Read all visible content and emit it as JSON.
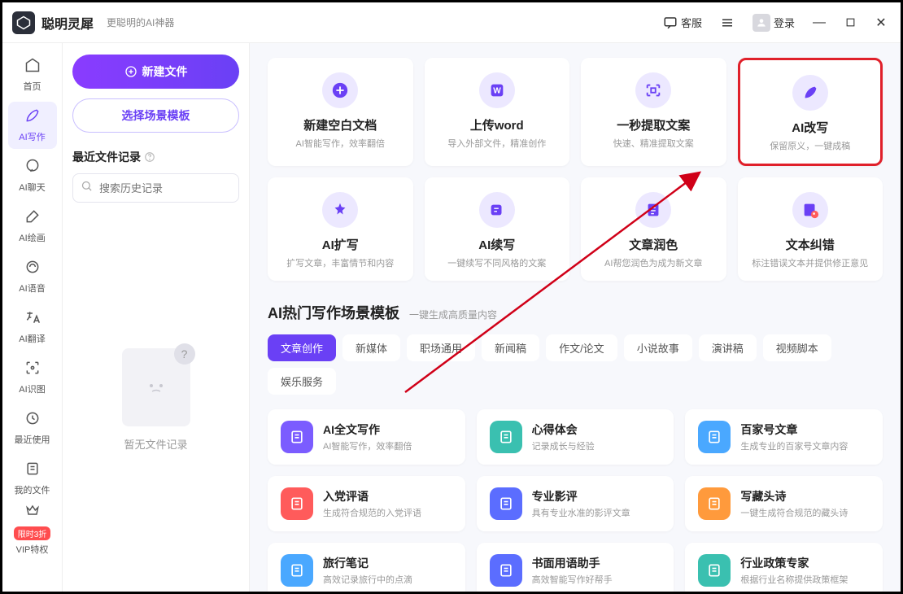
{
  "titlebar": {
    "app_name": "聪明灵犀",
    "app_sub": "更聪明的AI神器",
    "customer_service": "客服",
    "login": "登录"
  },
  "sidebar": {
    "items": [
      {
        "icon": "home-icon",
        "label": "首页"
      },
      {
        "icon": "pen-icon",
        "label": "AI写作"
      },
      {
        "icon": "chat-icon",
        "label": "AI聊天"
      },
      {
        "icon": "paint-icon",
        "label": "AI绘画"
      },
      {
        "icon": "audio-icon",
        "label": "AI语音"
      },
      {
        "icon": "translate-icon",
        "label": "AI翻译"
      },
      {
        "icon": "vision-icon",
        "label": "AI识图"
      },
      {
        "icon": "history-icon",
        "label": "最近使用"
      },
      {
        "icon": "file-icon",
        "label": "我的文件"
      },
      {
        "icon": "vip-icon",
        "label": "VIP特权",
        "badge": "限时3折"
      }
    ]
  },
  "leftpanel": {
    "new_file": "新建文件",
    "choose_template": "选择场景模板",
    "recent_title": "最近文件记录",
    "search_placeholder": "搜索历史记录",
    "empty_text": "暂无文件记录"
  },
  "action_cards": [
    {
      "icon": "plus-icon",
      "title": "新建空白文档",
      "desc": "AI智能写作，效率翻倍"
    },
    {
      "icon": "word-icon",
      "title": "上传word",
      "desc": "导入外部文件，精准创作"
    },
    {
      "icon": "extract-icon",
      "title": "一秒提取文案",
      "desc": "快速、精准提取文案"
    },
    {
      "icon": "rewrite-icon",
      "title": "AI改写",
      "desc": "保留原义，一键成稿",
      "highlighted": true
    },
    {
      "icon": "expand-icon",
      "title": "AI扩写",
      "desc": "扩写文章，丰富情节和内容"
    },
    {
      "icon": "continue-icon",
      "title": "AI续写",
      "desc": "一键续写不同风格的文案"
    },
    {
      "icon": "polish-icon",
      "title": "文章润色",
      "desc": "AI帮您润色为成为新文章"
    },
    {
      "icon": "correct-icon",
      "title": "文本纠错",
      "desc": "标注错误文本并提供修正意见"
    }
  ],
  "hot_section": {
    "title": "AI热门写作场景模板",
    "subtitle": "一键生成高质量内容"
  },
  "tabs": [
    "文章创作",
    "新媒体",
    "职场通用",
    "新闻稿",
    "作文/论文",
    "小说故事",
    "演讲稿",
    "视频脚本",
    "娱乐服务"
  ],
  "templates": [
    {
      "color": "c-purple",
      "title": "AI全文写作",
      "desc": "AI智能写作，效率翻倍"
    },
    {
      "color": "c-teal",
      "title": "心得体会",
      "desc": "记录成长与经验"
    },
    {
      "color": "c-blue",
      "title": "百家号文章",
      "desc": "生成专业的百家号文章内容"
    },
    {
      "color": "c-red",
      "title": "入党评语",
      "desc": "生成符合规范的入党评语"
    },
    {
      "color": "c-indigo",
      "title": "专业影评",
      "desc": "具有专业水准的影评文章"
    },
    {
      "color": "c-orange",
      "title": "写藏头诗",
      "desc": "一键生成符合规范的藏头诗"
    },
    {
      "color": "c-blue",
      "title": "旅行笔记",
      "desc": "高效记录旅行中的点滴"
    },
    {
      "color": "c-indigo",
      "title": "书面用语助手",
      "desc": "高效智能写作好帮手"
    },
    {
      "color": "c-teal",
      "title": "行业政策专家",
      "desc": "根据行业名称提供政策框架"
    }
  ]
}
